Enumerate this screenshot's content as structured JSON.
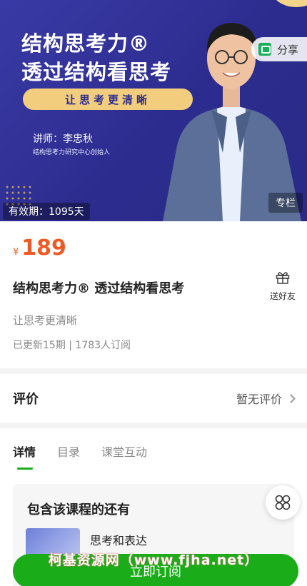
{
  "banner": {
    "title_line1": "结构思考力®",
    "title_line2": "透过结构看思考",
    "pill_text": "让思考更清晰",
    "teacher_label": "讲师：李忠秋",
    "teacher_sub": "结构思考力研究中心创始人",
    "share_label": "分享",
    "validity": "有效期：1095天",
    "type_badge": "专栏"
  },
  "info": {
    "currency": "¥",
    "price": "189",
    "title": "结构思考力® 透过结构看思考",
    "gift_label": "送好友",
    "subtitle": "让思考更清晰",
    "meta": "已更新15期 | 1783人订阅"
  },
  "review": {
    "label": "评价",
    "value": "暂无评价"
  },
  "tabs": [
    {
      "label": "详情",
      "active": true
    },
    {
      "label": "目录",
      "active": false
    },
    {
      "label": "课堂互动",
      "active": false
    }
  ],
  "included": {
    "heading": "包含该课程的还有",
    "items": [
      {
        "title": "思考和表达"
      }
    ]
  },
  "watermark": "柯基资源网（www.fjha.net）",
  "buy_button": "立即订阅",
  "colors": {
    "accent_green": "#1aad19",
    "price_orange": "#f05a22",
    "banner_blue": "#2c2c8f",
    "pill_gold": "#f2cd7e"
  }
}
